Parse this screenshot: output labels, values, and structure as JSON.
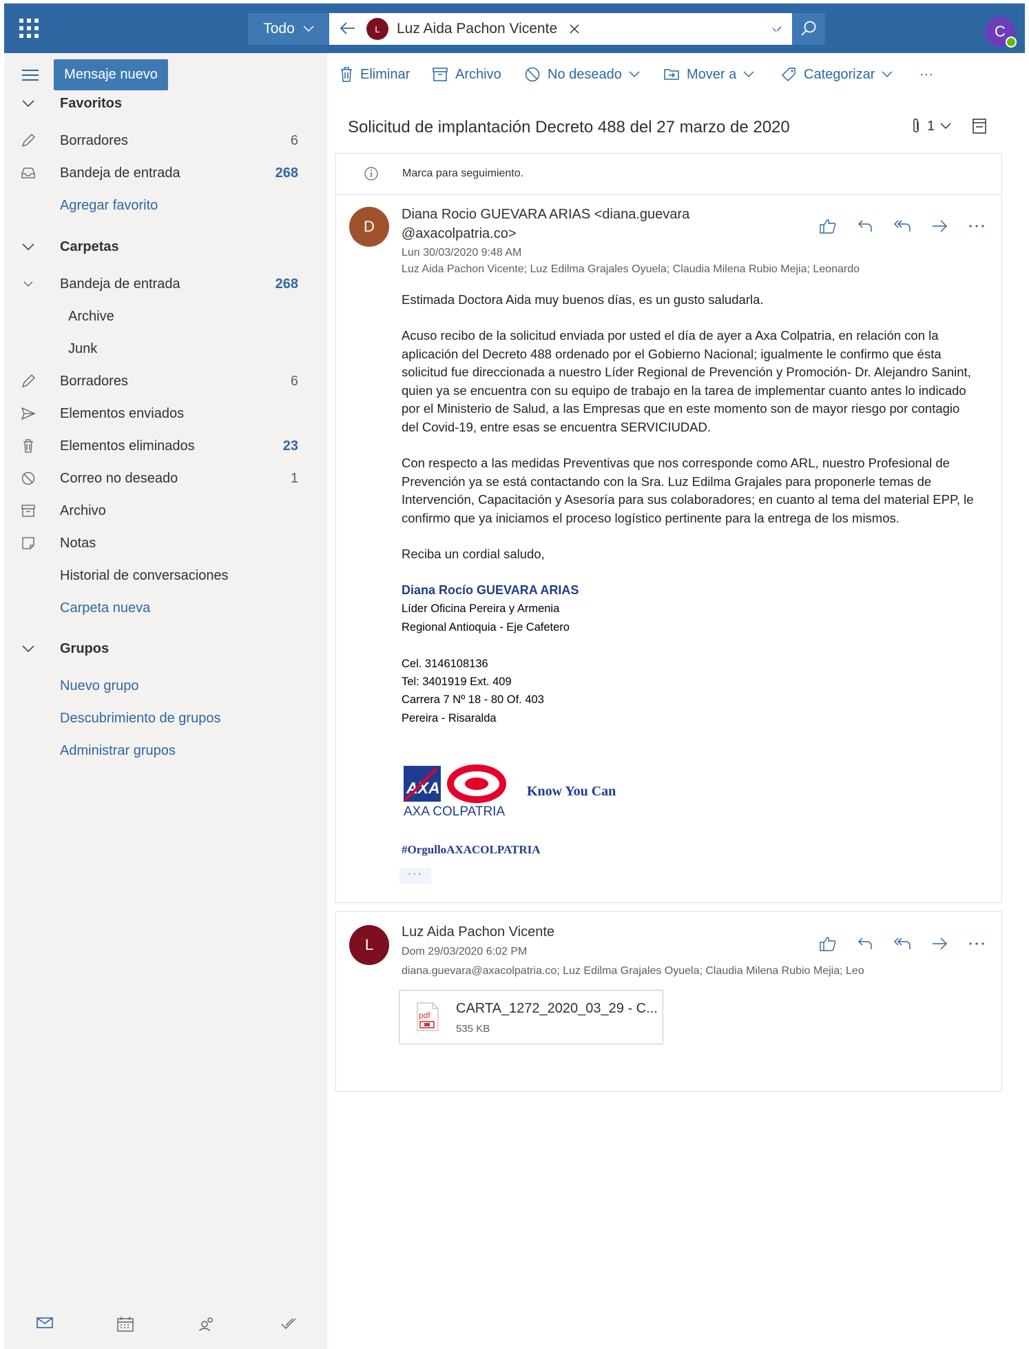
{
  "topbar": {
    "scope_label": "Todo",
    "search_chip": {
      "initial": "L",
      "name": "Luz Aida Pachon Vicente"
    },
    "user_initial": "C"
  },
  "nav": {
    "new_message": "Mensaje nuevo",
    "favorites_header": "Favoritos",
    "favorites": [
      {
        "label": "Borradores",
        "count": "6"
      },
      {
        "label": "Bandeja de entrada",
        "count": "268"
      },
      {
        "label": "Agregar favorito"
      }
    ],
    "folders_header": "Carpetas",
    "folders": [
      {
        "label": "Bandeja de entrada",
        "count": "268"
      },
      {
        "label": "Archive"
      },
      {
        "label": "Junk"
      },
      {
        "label": "Borradores",
        "count": "6"
      },
      {
        "label": "Elementos enviados"
      },
      {
        "label": "Elementos eliminados",
        "count": "23"
      },
      {
        "label": "Correo no deseado",
        "count": "1"
      },
      {
        "label": "Archivo"
      },
      {
        "label": "Notas"
      },
      {
        "label": "Historial de conversaciones"
      },
      {
        "label": "Carpeta nueva"
      }
    ],
    "groups_header": "Grupos",
    "groups": [
      {
        "label": "Nuevo grupo"
      },
      {
        "label": "Descubrimiento de grupos"
      },
      {
        "label": "Administrar grupos"
      }
    ]
  },
  "commands": {
    "delete": "Eliminar",
    "archive": "Archivo",
    "junk": "No deseado",
    "move": "Mover a",
    "categorize": "Categorizar",
    "more": "···"
  },
  "reading": {
    "subject": "Solicitud de implantación Decreto 488 del 27 marzo de 2020",
    "attachment_count": "1",
    "flag_notice": "Marca para seguimiento.",
    "message1": {
      "initial": "D",
      "avatar_color": "#a0522d",
      "sender_line1": "Diana Rocio GUEVARA ARIAS <diana.guevara",
      "sender_line2": "@axacolpatria.co>",
      "date": "Lun 30/03/2020 9:48 AM",
      "recipients": "Luz Aida Pachon Vicente; Luz Edilma Grajales Oyuela; Claudia Milena Rubio Mejia; Leonardo",
      "greeting": "Estimada Doctora Aida muy buenos días, es un gusto saludarla.",
      "paragraph1": "Acuso recibo de la solicitud enviada por usted el día de ayer a Axa Colpatria, en relación con la aplicación del Decreto 488 ordenado por el Gobierno Nacional; igualmente le confirmo que ésta solicitud fue direccionada a nuestro Líder Regional de Prevención y Promoción- Dr. Alejandro Sanint, quien ya se encuentra con su equipo de trabajo en la tarea de implementar cuanto antes lo indicado por el Ministerio de Salud, a las Empresas que en este momento son de mayor riesgo por contagio del Covid-19, entre esas se encuentra SERVICIUDAD.",
      "paragraph2": "Con respecto a las medidas Preventivas que nos corresponde como ARL, nuestro Profesional de Prevención ya se está contactando con la Sra. Luz Edilma Grajales para proponerle temas de Intervención, Capacitación y Asesoría para sus colaboradores; en cuanto al tema del material EPP, le confirmo que ya iniciamos el proceso logístico pertinente para la entrega de los mismos.",
      "closing": "Reciba un cordial saludo,",
      "signature": {
        "name": "Diana Rocío GUEVARA ARIAS",
        "title": "Líder Oficina Pereira y Armenia",
        "region": "Regional Antioquia - Eje Cafetero",
        "cel": "Cel. 3146108136",
        "tel": "Tel: 3401919 Ext. 409",
        "address": "Carrera 7 Nº 18 - 80 Of. 403",
        "city": "Pereira - Risaralda",
        "logo_text": "AXA COLPATRIA",
        "logo_mark": "AXA",
        "tagline": "Know You Can",
        "hashtag": "#OrgulloAXACOLPATRIA"
      }
    },
    "message2": {
      "initial": "L",
      "avatar_color": "#7d1020",
      "sender": "Luz Aida Pachon Vicente",
      "date": "Dom 29/03/2020 6:02 PM",
      "recipients": "diana.guevara@axacolpatria.co; Luz Edilma Grajales Oyuela; Claudia Milena Rubio Mejia; Leo",
      "attachment": {
        "name": "CARTA_1272_2020_03_29 - C...",
        "size": "535 KB",
        "type_label": "pdf"
      }
    }
  },
  "colors": {
    "brand": "#2f67a2",
    "nav_bg": "#f3f2f1",
    "axa_blue": "#1f3c8f",
    "axa_red": "#e4002b"
  }
}
